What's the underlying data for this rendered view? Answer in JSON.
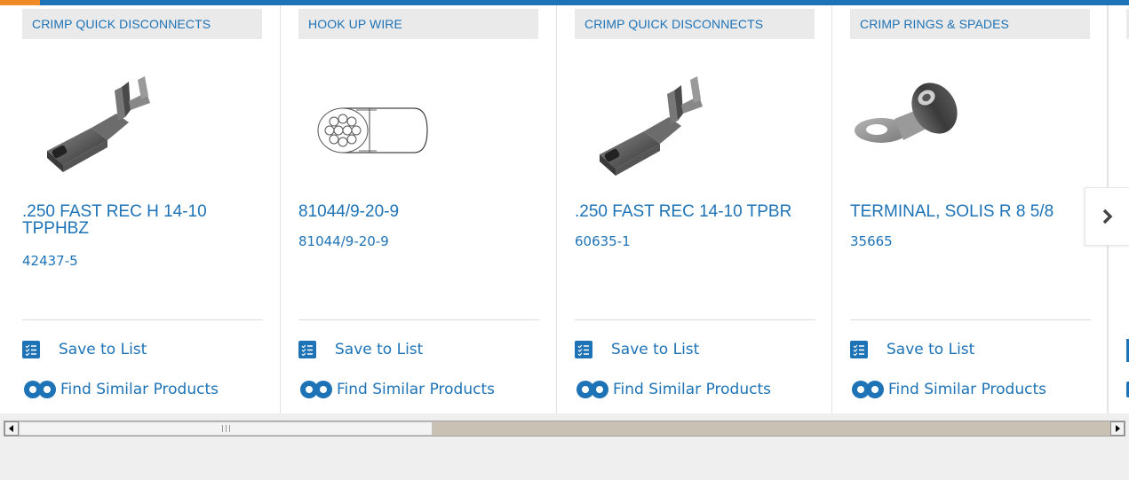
{
  "carousel": {
    "cards": [
      {
        "category": "CRIMP QUICK DISCONNECTS",
        "name": ".250 FAST REC H 14-10 TPPHBZ",
        "part_number": "42437-5",
        "image_icon": "quick-disconnect-terminal-icon",
        "save_label": "Save to List",
        "find_label": "Find Similar Products"
      },
      {
        "category": "HOOK UP WIRE",
        "name": "81044/9-20-9",
        "part_number": "81044/9-20-9",
        "image_icon": "stranded-wire-icon",
        "save_label": "Save to List",
        "find_label": "Find Similar Products"
      },
      {
        "category": "CRIMP QUICK DISCONNECTS",
        "name": ".250 FAST REC 14-10 TPBR",
        "part_number": "60635-1",
        "image_icon": "quick-disconnect-terminal-icon",
        "save_label": "Save to List",
        "find_label": "Find Similar Products"
      },
      {
        "category": "CRIMP RINGS & SPADES",
        "name": "TERMINAL, SOLIS R 8 5/8",
        "part_number": "35665",
        "image_icon": "ring-terminal-icon",
        "save_label": "Save to List",
        "find_label": "Find Similar Products"
      }
    ],
    "next_icon": "chevron-right-icon"
  },
  "scrollbar": {
    "left_icon": "arrow-left-icon",
    "right_icon": "arrow-right-icon"
  },
  "colors": {
    "link": "#1e73b6",
    "accent": "#f08a24",
    "category_bg": "#eaeaea"
  }
}
